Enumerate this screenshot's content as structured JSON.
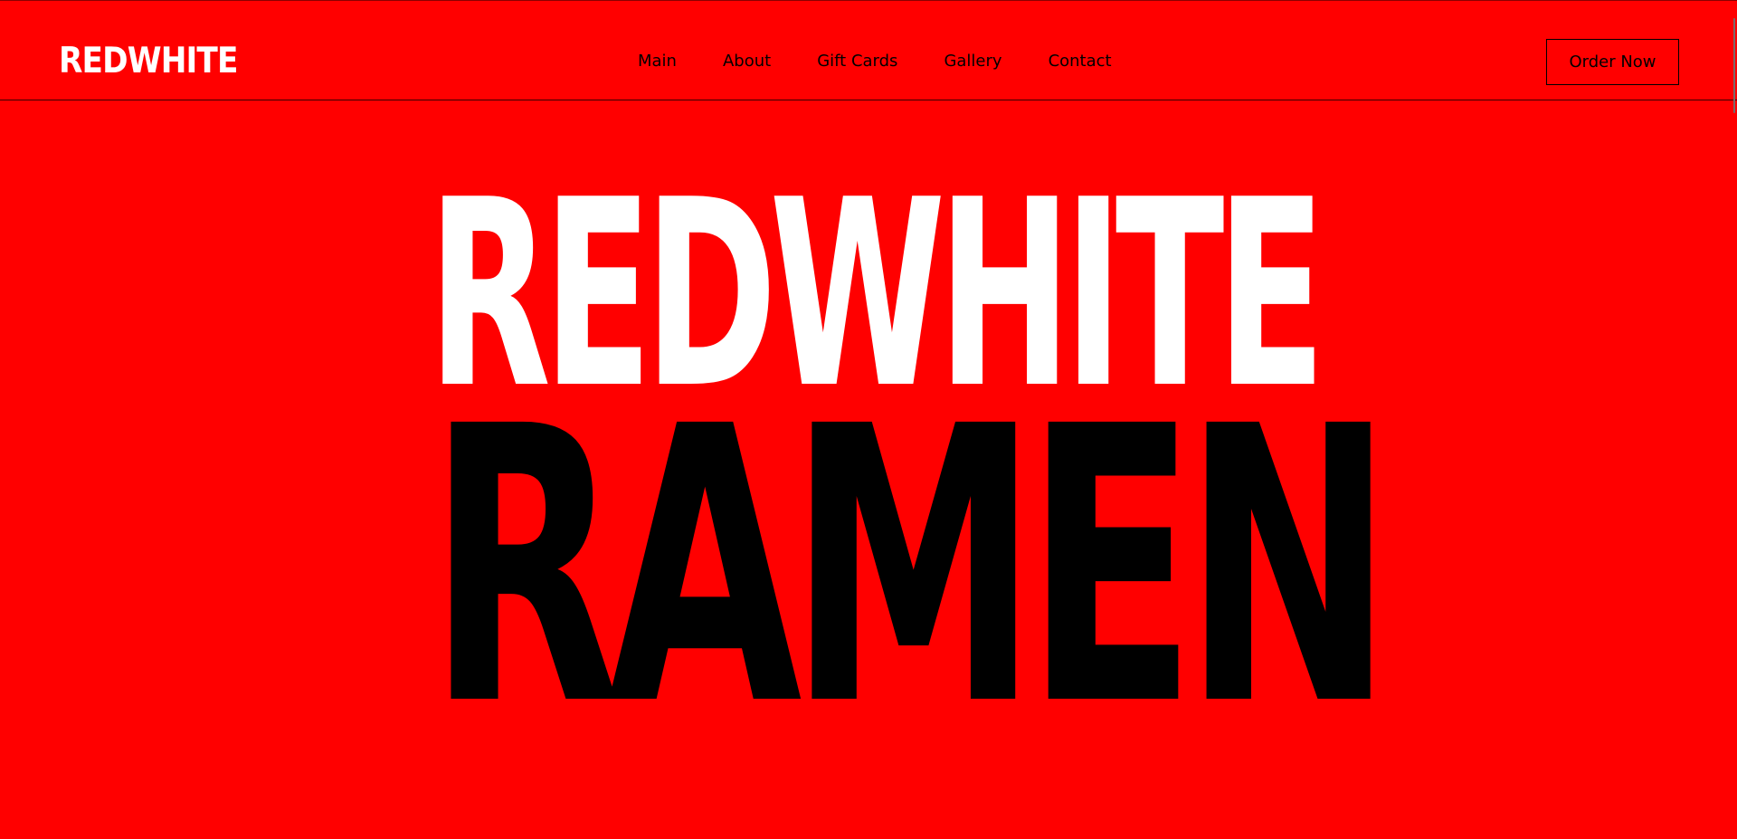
{
  "header": {
    "logo": "REDWHITE",
    "nav": [
      "Main",
      "About",
      "Gift Cards",
      "Gallery",
      "Contact"
    ],
    "cta": "Order Now"
  },
  "hero": {
    "line1": "REDWHITE",
    "line2": "RAMEN"
  },
  "colors": {
    "background": "#ff0000",
    "logo": "#ffffff",
    "text": "#000000"
  }
}
